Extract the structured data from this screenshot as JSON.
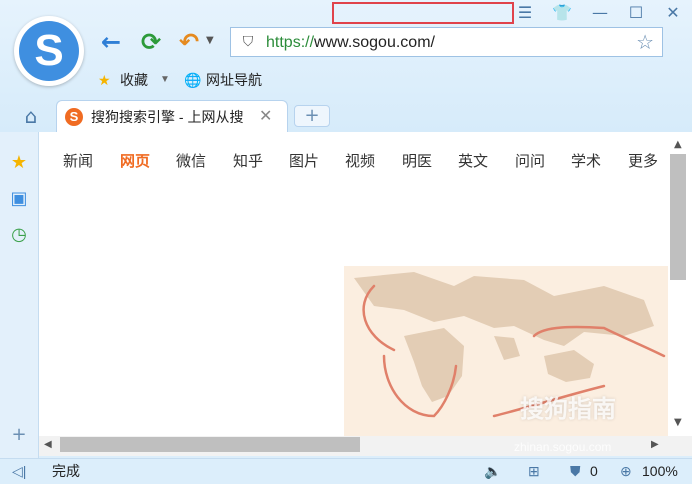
{
  "titlebar": {
    "menu_icon": "menu-icon",
    "skin_icon": "shirt-icon",
    "minimize": "—",
    "maximize": "☐",
    "close": "✕"
  },
  "toolbar": {
    "back": "←",
    "refresh": "⟳",
    "undo": "↶"
  },
  "address": {
    "scheme": "https://",
    "host": "www.sogou.com/"
  },
  "bookmarks": {
    "favorites_label": "收藏",
    "nav_label": "网址导航"
  },
  "tab": {
    "favicon_letter": "S",
    "title": "搜狗搜索引擎 - 上网从搜",
    "close": "✕"
  },
  "new_tab": "+",
  "sogou_nav": [
    "新闻",
    "网页",
    "微信",
    "知乎",
    "图片",
    "视频",
    "明医",
    "英文",
    "问问",
    "学术",
    "更多"
  ],
  "active_nav": "网页",
  "status": {
    "text": "完成",
    "count": "0",
    "zoom": "100%"
  },
  "watermark": {
    "brand": "搜狗指南",
    "url": "zhinan.sogou.com"
  },
  "colors": {
    "accent": "#f06b22",
    "chrome": "#dceefb",
    "link_green": "#2c8c3a",
    "highlight_box": "#e0434b"
  }
}
